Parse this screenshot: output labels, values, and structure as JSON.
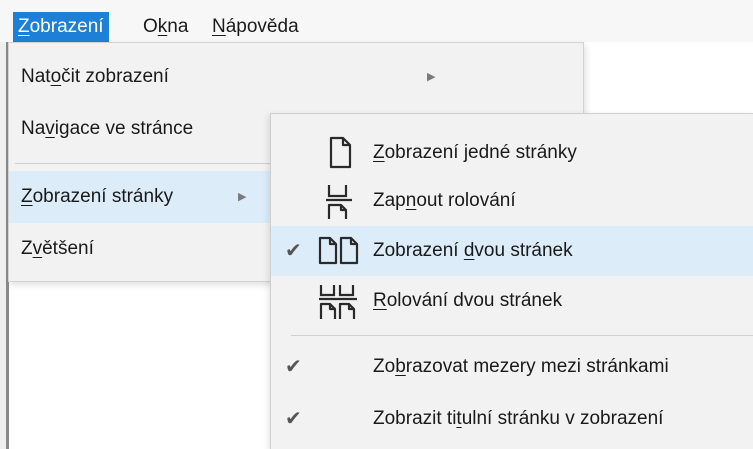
{
  "menubar": {
    "items": [
      {
        "pre": "",
        "key": "Z",
        "post": "obrazení",
        "active": true
      },
      {
        "pre": "O",
        "key": "k",
        "post": "na",
        "active": false
      },
      {
        "pre": "",
        "key": "N",
        "post": "ápověda",
        "active": false
      }
    ]
  },
  "view_menu": {
    "items": [
      {
        "pre": "Nat",
        "key": "o",
        "post": "čit zobrazení",
        "has_submenu": true
      },
      {
        "pre": "Na",
        "key": "v",
        "post": "igace ve stránce",
        "has_submenu": false
      },
      {
        "pre": "",
        "key": "Z",
        "post": "obrazení stránky",
        "has_submenu": true
      },
      {
        "pre": "Z",
        "key": "v",
        "post": "ětšení",
        "has_submenu": false
      }
    ]
  },
  "page_display_submenu": {
    "items": [
      {
        "pre": "",
        "key": "Z",
        "post": "obrazení jedné stránky",
        "icon": "single-page-icon",
        "checked": false
      },
      {
        "pre": "Zap",
        "key": "n",
        "post": "out rolování",
        "icon": "enable-scrolling-icon",
        "checked": false
      },
      {
        "pre": "Zobrazení ",
        "key": "d",
        "post": "vou stránek",
        "icon": "two-page-icon",
        "checked": true
      },
      {
        "pre": "",
        "key": "R",
        "post": "olování dvou stránek",
        "icon": "two-page-scrolling-icon",
        "checked": false
      },
      {
        "pre": "Zo",
        "key": "b",
        "post": "razovat mezery mezi stránkami",
        "icon": "check-icon",
        "checked": true
      },
      {
        "pre": "Zobrazit ti",
        "key": "t",
        "post": "ulní stránku v zobrazení",
        "icon": "check-icon",
        "checked": true
      }
    ],
    "check_glyph": "✔"
  }
}
